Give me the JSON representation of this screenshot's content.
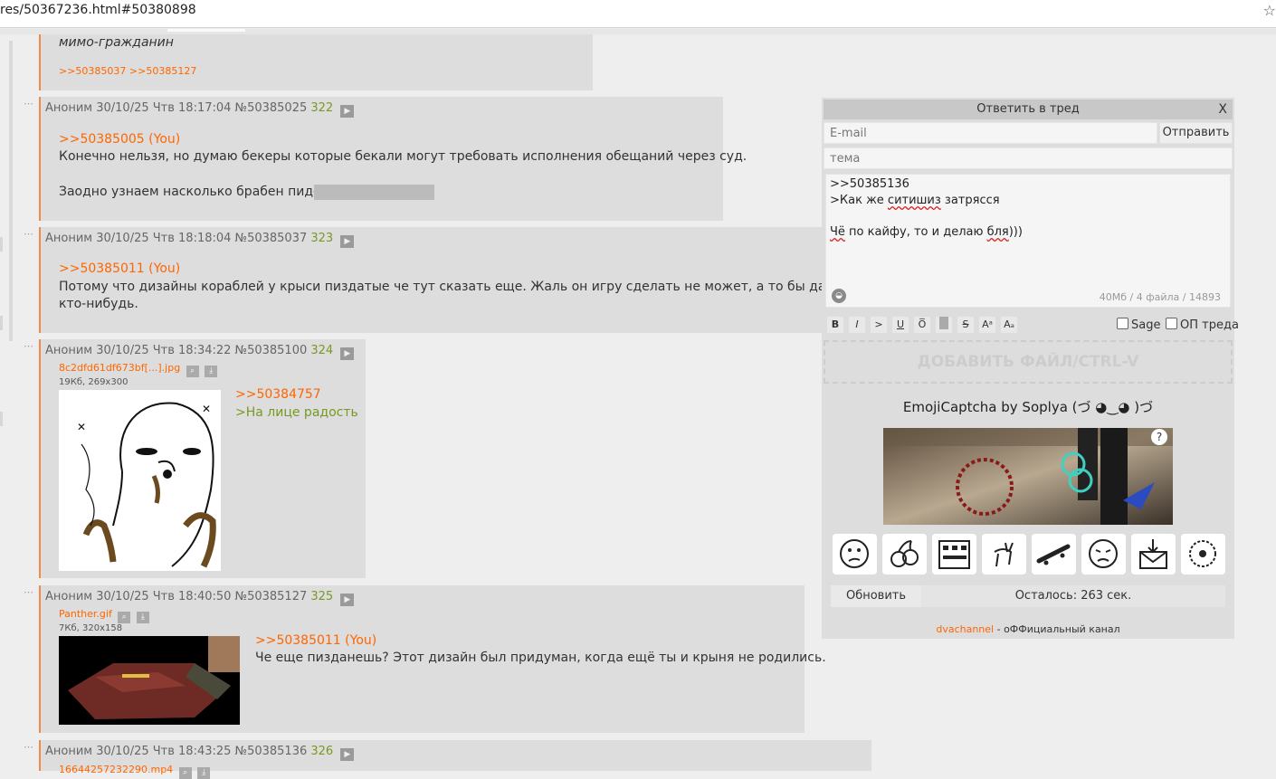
{
  "browser": {
    "url": "res/50367236.html#50380898",
    "star_icon": "star-icon"
  },
  "post_prev": {
    "signature": "мимо-гражданин",
    "links": ">>50385037 >>50385127"
  },
  "posts": [
    {
      "header": "Аноним 30/10/25 Чтв 18:17:04 №50385025",
      "count": "322",
      "reply": ">>50385005 (You)",
      "line1": "Конечно нельзя, но думаю бекеры которые бекали могут требовать исполнения обещаний через суд.",
      "line2": "Заодно узнаем насколько брабен пидор"
    },
    {
      "header": "Аноним 30/10/25 Чтв 18:18:04 №50385037",
      "count": "323",
      "reply": ">>50385011 (You)",
      "line1": "Потому что дизайны кораблей у крыси пиздатые че тут сказать еще. Жаль он игру сделать не может, а то бы даже игра",
      "line2": "кто-нибудь."
    },
    {
      "header": "Аноним 30/10/25 Чтв 18:34:22 №50385100",
      "count": "324",
      "file": "8c2dfd61df673bf[...].jpg",
      "file_meta": "19Кб, 269x300",
      "reply": ">>50384757",
      "greentext": ">На лице радость"
    },
    {
      "header": "Аноним 30/10/25 Чтв 18:40:50 №50385127",
      "count": "325",
      "file": "Panther.gif",
      "file_meta": "7Кб, 320x158",
      "reply": ">>50385011 (You)",
      "line1": "Че еще пизданешь? Этот дизайн был придуман, когда ещё ты и крыня не родились."
    },
    {
      "header": "Аноним 30/10/25 Чтв 18:43:25 №50385136",
      "count": "326",
      "file": "16644257232290.mp4"
    }
  ],
  "reply_form": {
    "title": "Ответить в тред",
    "close": "X",
    "email_placeholder": "E-mail",
    "send": "Отправить",
    "subject_placeholder": "тема",
    "message": {
      "line1": ">>50385136",
      "line2_a": ">Как же ",
      "line2_b": "ситишиз",
      "line2_c": " затрясся",
      "line3_a": "Чё",
      "line3_b": " по кайфу, то и делаю ",
      "line3_c": "бля",
      "line3_d": ")))"
    },
    "limits": "40Мб / 4 файла / 14893",
    "markup": [
      "B",
      "I",
      ">",
      "U",
      "O̅",
      "",
      "S",
      "Aᵃ",
      "Aₐ"
    ],
    "sage": "Sage",
    "op": "ОП треда",
    "dropzone": "ДОБАВИТЬ ФАЙЛ/CTRL-V",
    "captcha_title": "EmojiCaptcha by Soplya (づ ◕‿◕ )づ",
    "captcha_help": "?",
    "emoji_icons": [
      "thinking-face-icon",
      "cherries-icon",
      "building-icon",
      "goat-icon",
      "skateboard-icon",
      "steam-face-icon",
      "inbox-tray-icon",
      "badge-icon"
    ],
    "refresh": "Обновить",
    "remaining": "Осталось: 263 сек.",
    "channel_link": "dvachannel",
    "channel_text": " - оФФициальный канал"
  }
}
